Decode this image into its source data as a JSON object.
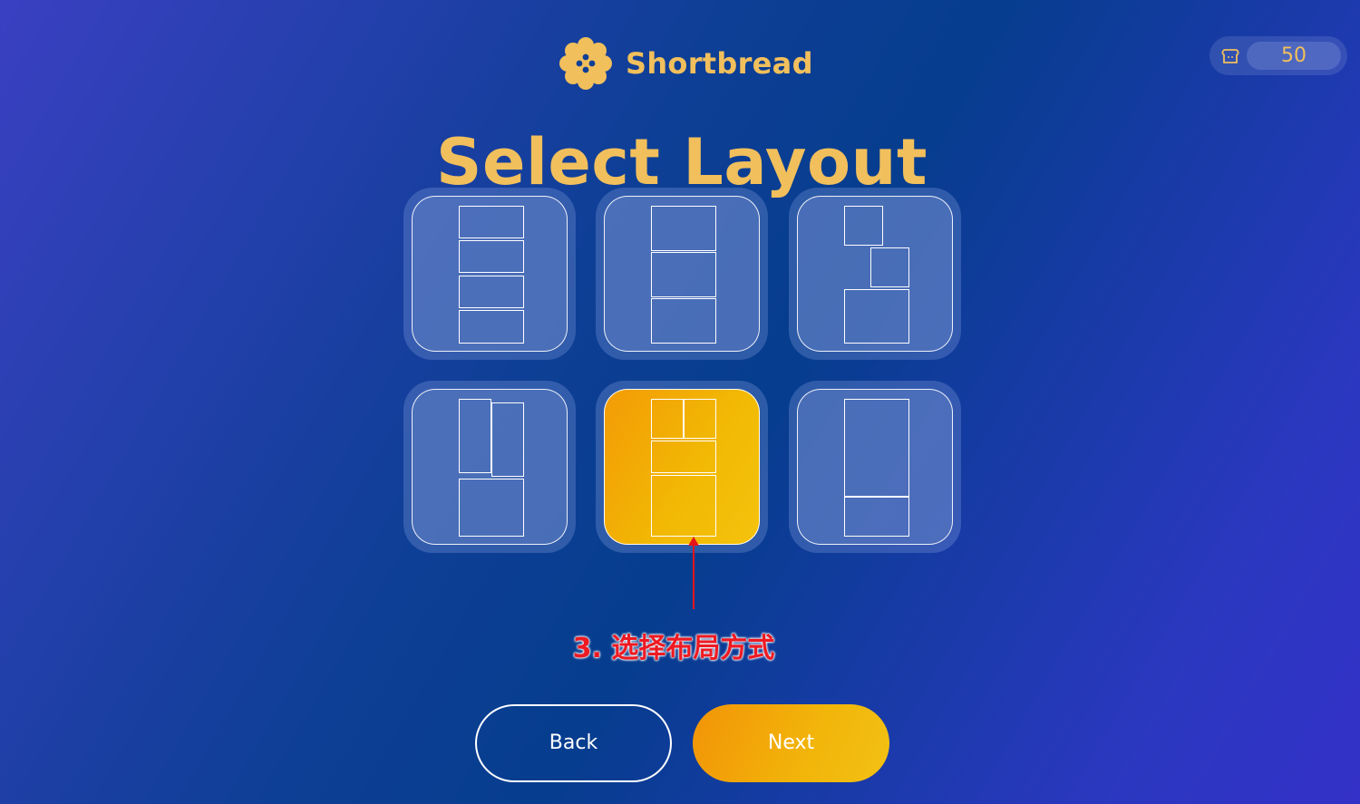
{
  "app": {
    "name": "Shortbread",
    "logo_icon": "cookie-logo-icon"
  },
  "credits": {
    "icon": "bread-icon",
    "value": "50"
  },
  "page": {
    "title": "Select Layout"
  },
  "layouts": [
    {
      "id": "four-stacked",
      "selected": false
    },
    {
      "id": "three-stacked",
      "selected": false
    },
    {
      "id": "staggered-two-plus-one",
      "selected": false
    },
    {
      "id": "two-tall-plus-bottom",
      "selected": false
    },
    {
      "id": "two-top-plus-two-stacked",
      "selected": true
    },
    {
      "id": "tall-plus-short",
      "selected": false
    }
  ],
  "annotation": {
    "text": "3. 选择布局方式"
  },
  "buttons": {
    "back_label": "Back",
    "next_label": "Next"
  },
  "colors": {
    "accent": "#f1bf5c",
    "selected_tile": "#f2b504",
    "annotation": "#ee1a22"
  }
}
